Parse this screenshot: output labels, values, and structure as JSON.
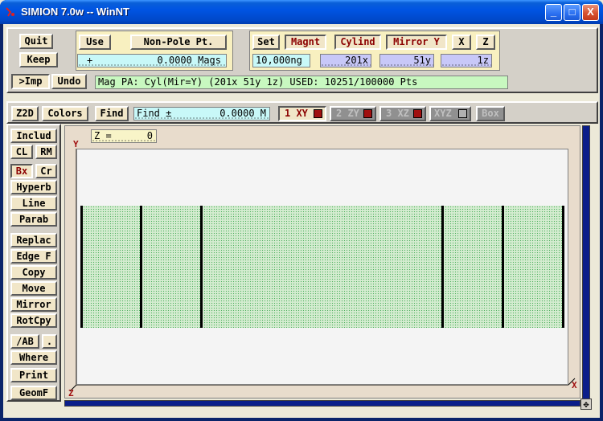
{
  "window": {
    "title": "SIMION 7.0w -- WinNT",
    "minimize": "_",
    "maximize": "□",
    "close": "X"
  },
  "top_panel": {
    "quit": "Quit",
    "keep": "Keep",
    "imp": ">Imp",
    "undo": "Undo",
    "use": "Use",
    "non_pole": "Non-Pole Pt.",
    "mag_sign": "+",
    "mag_value": "0.0000 Mags",
    "set": "Set",
    "magnt": "Magnt",
    "cylind": "Cylind",
    "mirror_y": "Mirror Y",
    "x": "X",
    "z": "Z",
    "ng": "10,000ng",
    "x_size": "201x",
    "y_size": "51y",
    "z_size": "1z",
    "status": "Mag PA: Cyl(Mir=Y) (201x 51y 1z)  USED: 10251/100000 Pts"
  },
  "view_toolbar": {
    "z2d": "Z2D",
    "colors": "Colors",
    "find": "Find",
    "find_field": "Find ±",
    "find_value": "0.0000 M",
    "view1": "1 XY",
    "view2": "2 ZY",
    "view3": "3 XZ",
    "view4": "XYZ",
    "box": "Box"
  },
  "left_tools": {
    "includ": "Includ",
    "cl": "CL",
    "rm": "RM",
    "bx": "Bx",
    "cr": "Cr",
    "hyperb": "Hyperb",
    "line": "Line",
    "parab": "Parab",
    "replac": "Replac",
    "edge_f": "Edge F",
    "copy": "Copy",
    "move": "Move",
    "mirror": "Mirror",
    "rotcpy": "RotCpy",
    "ab": "/AB",
    "dot": ".",
    "where": "Where",
    "print": "Print",
    "geomf": "GeomF"
  },
  "canvas": {
    "z_label": "Z =",
    "z_value": "0",
    "y_axis": "Y",
    "x_axis": "X",
    "z_axis": "Z"
  },
  "colors": {
    "accent": "#0054e3",
    "button_face": "#f1e6c8",
    "field_cyan": "#c8f8f8",
    "field_lavender": "#c8c8f8",
    "status_green": "#c8f8c0",
    "pa_fill": "#d4ecd0",
    "electrode": "#000000"
  }
}
